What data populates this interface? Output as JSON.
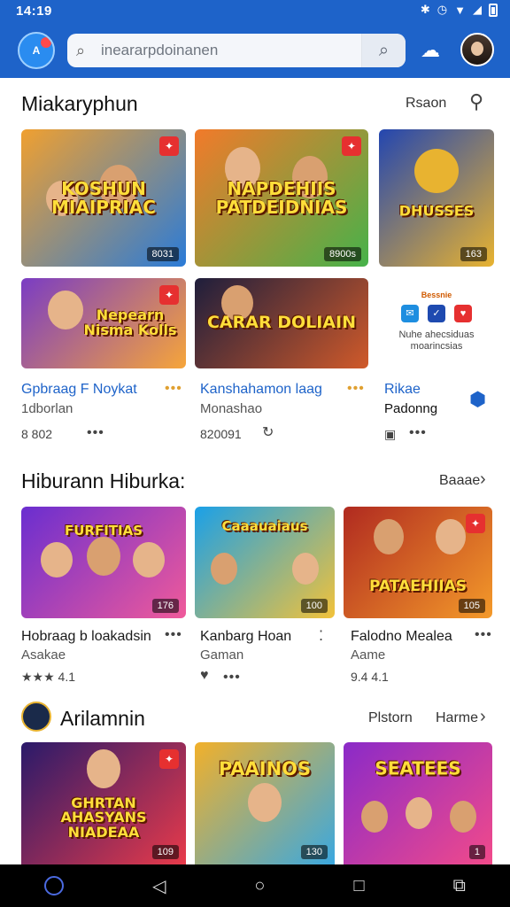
{
  "status_bar": {
    "time": "14:19"
  },
  "header": {
    "search_placeholder": "ineararpdoinanen",
    "app_logo_text": "A"
  },
  "section1": {
    "title": "Miakaryphun",
    "action": "Rsaon",
    "cards": [
      {
        "title": "KOSHUN MIAIPRIAC",
        "count": "8031",
        "colors": [
          "#f0a030",
          "#2a7bd8"
        ]
      },
      {
        "title": "NAPDEHIIS PATDEIDNIAS",
        "count": "8900s",
        "colors": [
          "#f27a2a",
          "#46b24a"
        ]
      },
      {
        "title": "DHUSSES",
        "count": "163",
        "colors": [
          "#2346b0",
          "#e8b330"
        ]
      },
      {
        "title": "Nepearn Nisma Kolls",
        "colors": [
          "#7a3cc4",
          "#f6a53a"
        ]
      },
      {
        "title": "CARAR DOLIAIN",
        "colors": [
          "#1e1e3c",
          "#d05a2a"
        ]
      }
    ],
    "promo": {
      "small": "Bessnie",
      "text": "Nuhe ahecsiduas moarincsias"
    },
    "items": [
      {
        "title": "Gpbraag F Noykat",
        "sub": "1dborlan",
        "extra": "8 802"
      },
      {
        "title": "Kanshahamon laag",
        "sub": "Monashao",
        "extra": "820091"
      },
      {
        "title": "Rikae",
        "sub": "Padonng",
        "extra": ""
      }
    ]
  },
  "section2": {
    "title": "Hiburann Hiburka:",
    "action": "Baaae",
    "cards": [
      {
        "title": "FURFITIAS",
        "count": "176",
        "colors": [
          "#6a2ed0",
          "#f05a9a"
        ]
      },
      {
        "title": "Caaauaiaus",
        "count": "100",
        "colors": [
          "#1aa0e8",
          "#f2c23a"
        ]
      },
      {
        "title": "PATAEHIIAS",
        "count": "105",
        "colors": [
          "#b02a20",
          "#f49a2a"
        ]
      }
    ],
    "items": [
      {
        "title": "Hobraag b loakadsin",
        "sub": "Asakae",
        "extra": "★★★ 4.1"
      },
      {
        "title": "Kanbarg Hoan",
        "sub": "Gaman",
        "extra": ""
      },
      {
        "title": "Falodno Mealea",
        "sub": "Aame",
        "extra": "9.4 4.1"
      }
    ]
  },
  "section3": {
    "title": "Arilamnin",
    "action1": "Plstorn",
    "action2": "Harme",
    "cards": [
      {
        "title": "GHRTAN AHASYANS NIADEAA",
        "count": "109",
        "colors": [
          "#2a1a6a",
          "#e83a4a"
        ]
      },
      {
        "title": "PAAINOS",
        "count": "130",
        "colors": [
          "#f2b02a",
          "#3aa8e0"
        ]
      },
      {
        "title": "SEATEES",
        "count": "1",
        "colors": [
          "#8a2ac8",
          "#f24a8a"
        ]
      }
    ]
  }
}
